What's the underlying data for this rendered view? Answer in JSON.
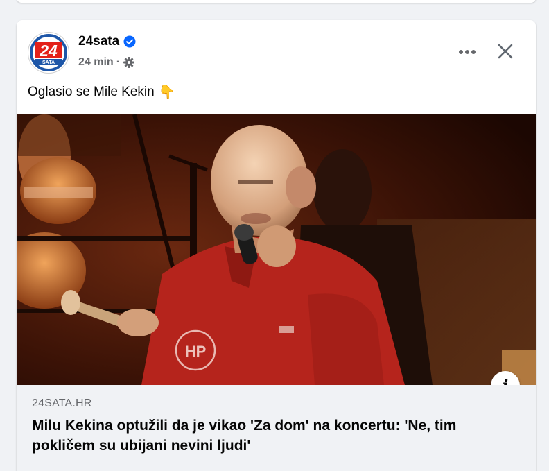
{
  "post": {
    "author": "24sata",
    "time": "24 min",
    "separator": "·",
    "text": "Oglasio se Mile Kekin",
    "emoji": "👇",
    "verified": true,
    "avatar_logo_number": "24",
    "avatar_logo_text": "SATA"
  },
  "link": {
    "domain": "24SATA.HR",
    "title": "Milu Kekina optužili da je vikao 'Za dom' na koncertu: 'Ne, tim pokličem su ubijani nevini ljudi'"
  },
  "image": {
    "shirt_logo": "HP"
  },
  "controls": {
    "info_glyph": "i"
  },
  "colors": {
    "brand_blue": "#1d56a8",
    "brand_red": "#e32119",
    "verified_blue": "#0866ff",
    "footer_bg": "#f0f2f5",
    "shirt_red": "#b5241c"
  }
}
